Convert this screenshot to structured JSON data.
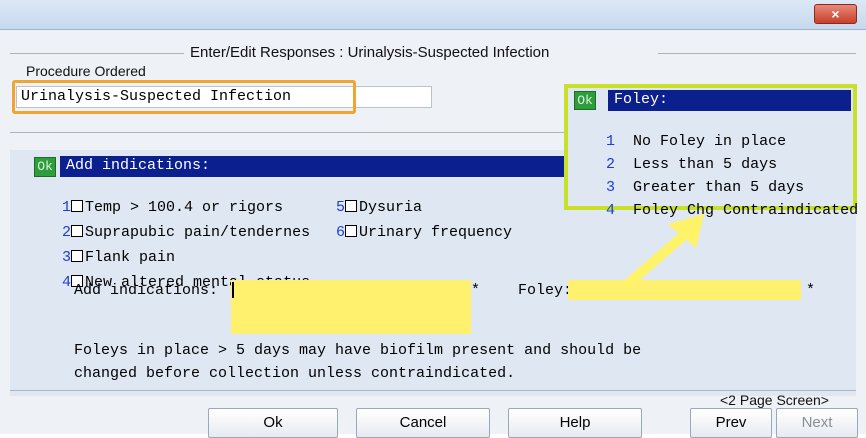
{
  "window": {
    "close_glyph": "×"
  },
  "form": {
    "title": "Enter/Edit Responses : Urinalysis-Suspected Infection",
    "procedure_label": "Procedure Ordered",
    "procedure_value": "Urinalysis-Suspected Infection"
  },
  "indications": {
    "ok_tag": "Ok",
    "header": "Add indications:",
    "options": [
      {
        "num": "1",
        "label": "Temp > 100.4 or rigors"
      },
      {
        "num": "2",
        "label": "Suprapubic pain/tendernes"
      },
      {
        "num": "3",
        "label": "Flank pain"
      },
      {
        "num": "4",
        "label": "New altered mental status"
      },
      {
        "num": "5",
        "label": "Dysuria"
      },
      {
        "num": "6",
        "label": "Urinary frequency"
      }
    ],
    "field_label": "Add indications:",
    "required_mark": "*",
    "field_value": ""
  },
  "foley": {
    "field_label": "Foley:",
    "required_mark": "*",
    "field_value": "",
    "popup": {
      "ok_tag": "Ok",
      "title": "Foley:",
      "options": [
        {
          "num": "1",
          "label": "No Foley in place"
        },
        {
          "num": "2",
          "label": "Less than 5 days"
        },
        {
          "num": "3",
          "label": "Greater than 5 days"
        },
        {
          "num": "4",
          "label": "Foley Chg Contraindicated"
        }
      ]
    }
  },
  "note": {
    "line1": "Foleys in place > 5 days may have biofilm present and should be",
    "line2": "changed before collection unless contraindicated."
  },
  "footer": {
    "page_screen": "<2 Page Screen>",
    "buttons": {
      "ok": "Ok",
      "cancel": "Cancel",
      "help": "Help",
      "prev": "Prev",
      "next": "Next"
    }
  },
  "colors": {
    "selection_bar": "#0b1f8f",
    "ok_tag": "#2e9d3b",
    "highlight_orange": "#f0a531",
    "highlight_lime": "#c8e02a",
    "input_yellow": "#fff16e"
  }
}
